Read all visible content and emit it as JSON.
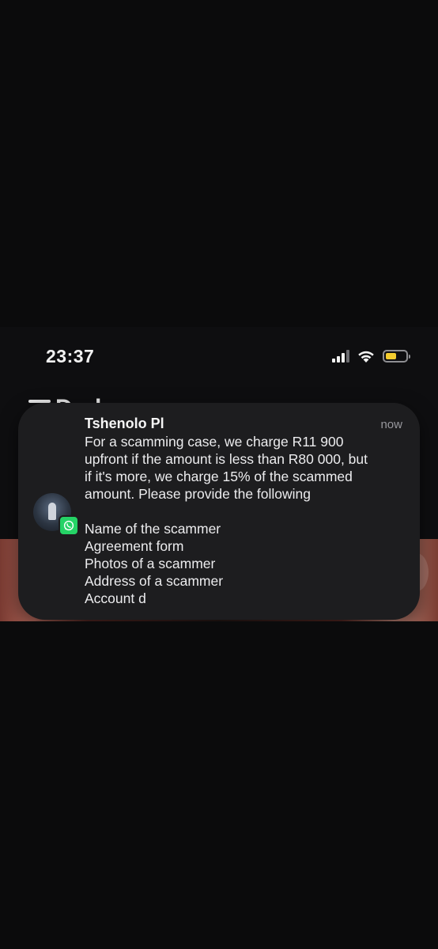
{
  "status_bar": {
    "time": "23:37",
    "battery_color": "#f3cc2f"
  },
  "background_app": {
    "header_peek": "Dod"
  },
  "notification": {
    "app_icon": "whatsapp-icon",
    "sender": "Tshenolo Pl",
    "timestamp": "now",
    "message_lines": [
      "For a scamming case, we charge R11 900",
      "upfront if the amount is less than R80 000, but",
      "if it's more, we charge 15% of the scammed",
      "amount. Please provide the following"
    ],
    "list_lines": [
      "Name of the scammer",
      "Agreement form",
      "Photos of a scammer",
      "Address of a scammer",
      "Account d"
    ]
  }
}
